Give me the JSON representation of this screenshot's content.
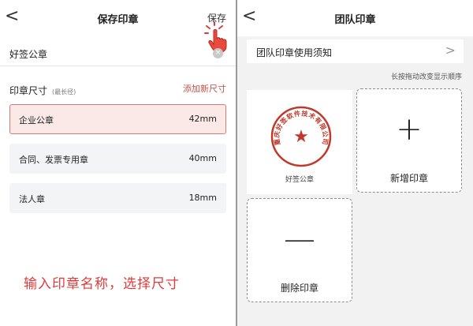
{
  "left": {
    "nav": {
      "back": "<",
      "title": "保存印章",
      "save": "保存"
    },
    "name": {
      "value": "好签公章",
      "clear": "×"
    },
    "size": {
      "label": "印章尺寸",
      "sub": "(最长径)",
      "add": "添加新尺寸"
    },
    "options": [
      {
        "name": "企业公章",
        "size": "42mm",
        "selected": true
      },
      {
        "name": "合同、发票专用章",
        "size": "40mm",
        "selected": false
      },
      {
        "name": "法人章",
        "size": "18mm",
        "selected": false
      }
    ],
    "instruction": "输入印章名称，选择尺寸"
  },
  "right": {
    "nav": {
      "back": "<",
      "title": "团队印章"
    },
    "notice": {
      "text": "团队印章使用须知",
      "chevron": ">"
    },
    "hint": "长按拖动改变显示顺序",
    "seal": {
      "caption": "好签公章",
      "ring_text": "重庆好签软件技术有限公司",
      "star": "★"
    },
    "add_card": {
      "symbol": "+",
      "label": "新增印章"
    },
    "delete_card": {
      "symbol": "—",
      "label": "删除印章"
    }
  },
  "colors": {
    "accent": "#c0504a",
    "instruction": "#e03a3a",
    "seal": "#c0392b"
  },
  "icons": {
    "back": "chevron-left-icon",
    "hand": "pointing-hand-icon",
    "clear": "clear-icon"
  }
}
